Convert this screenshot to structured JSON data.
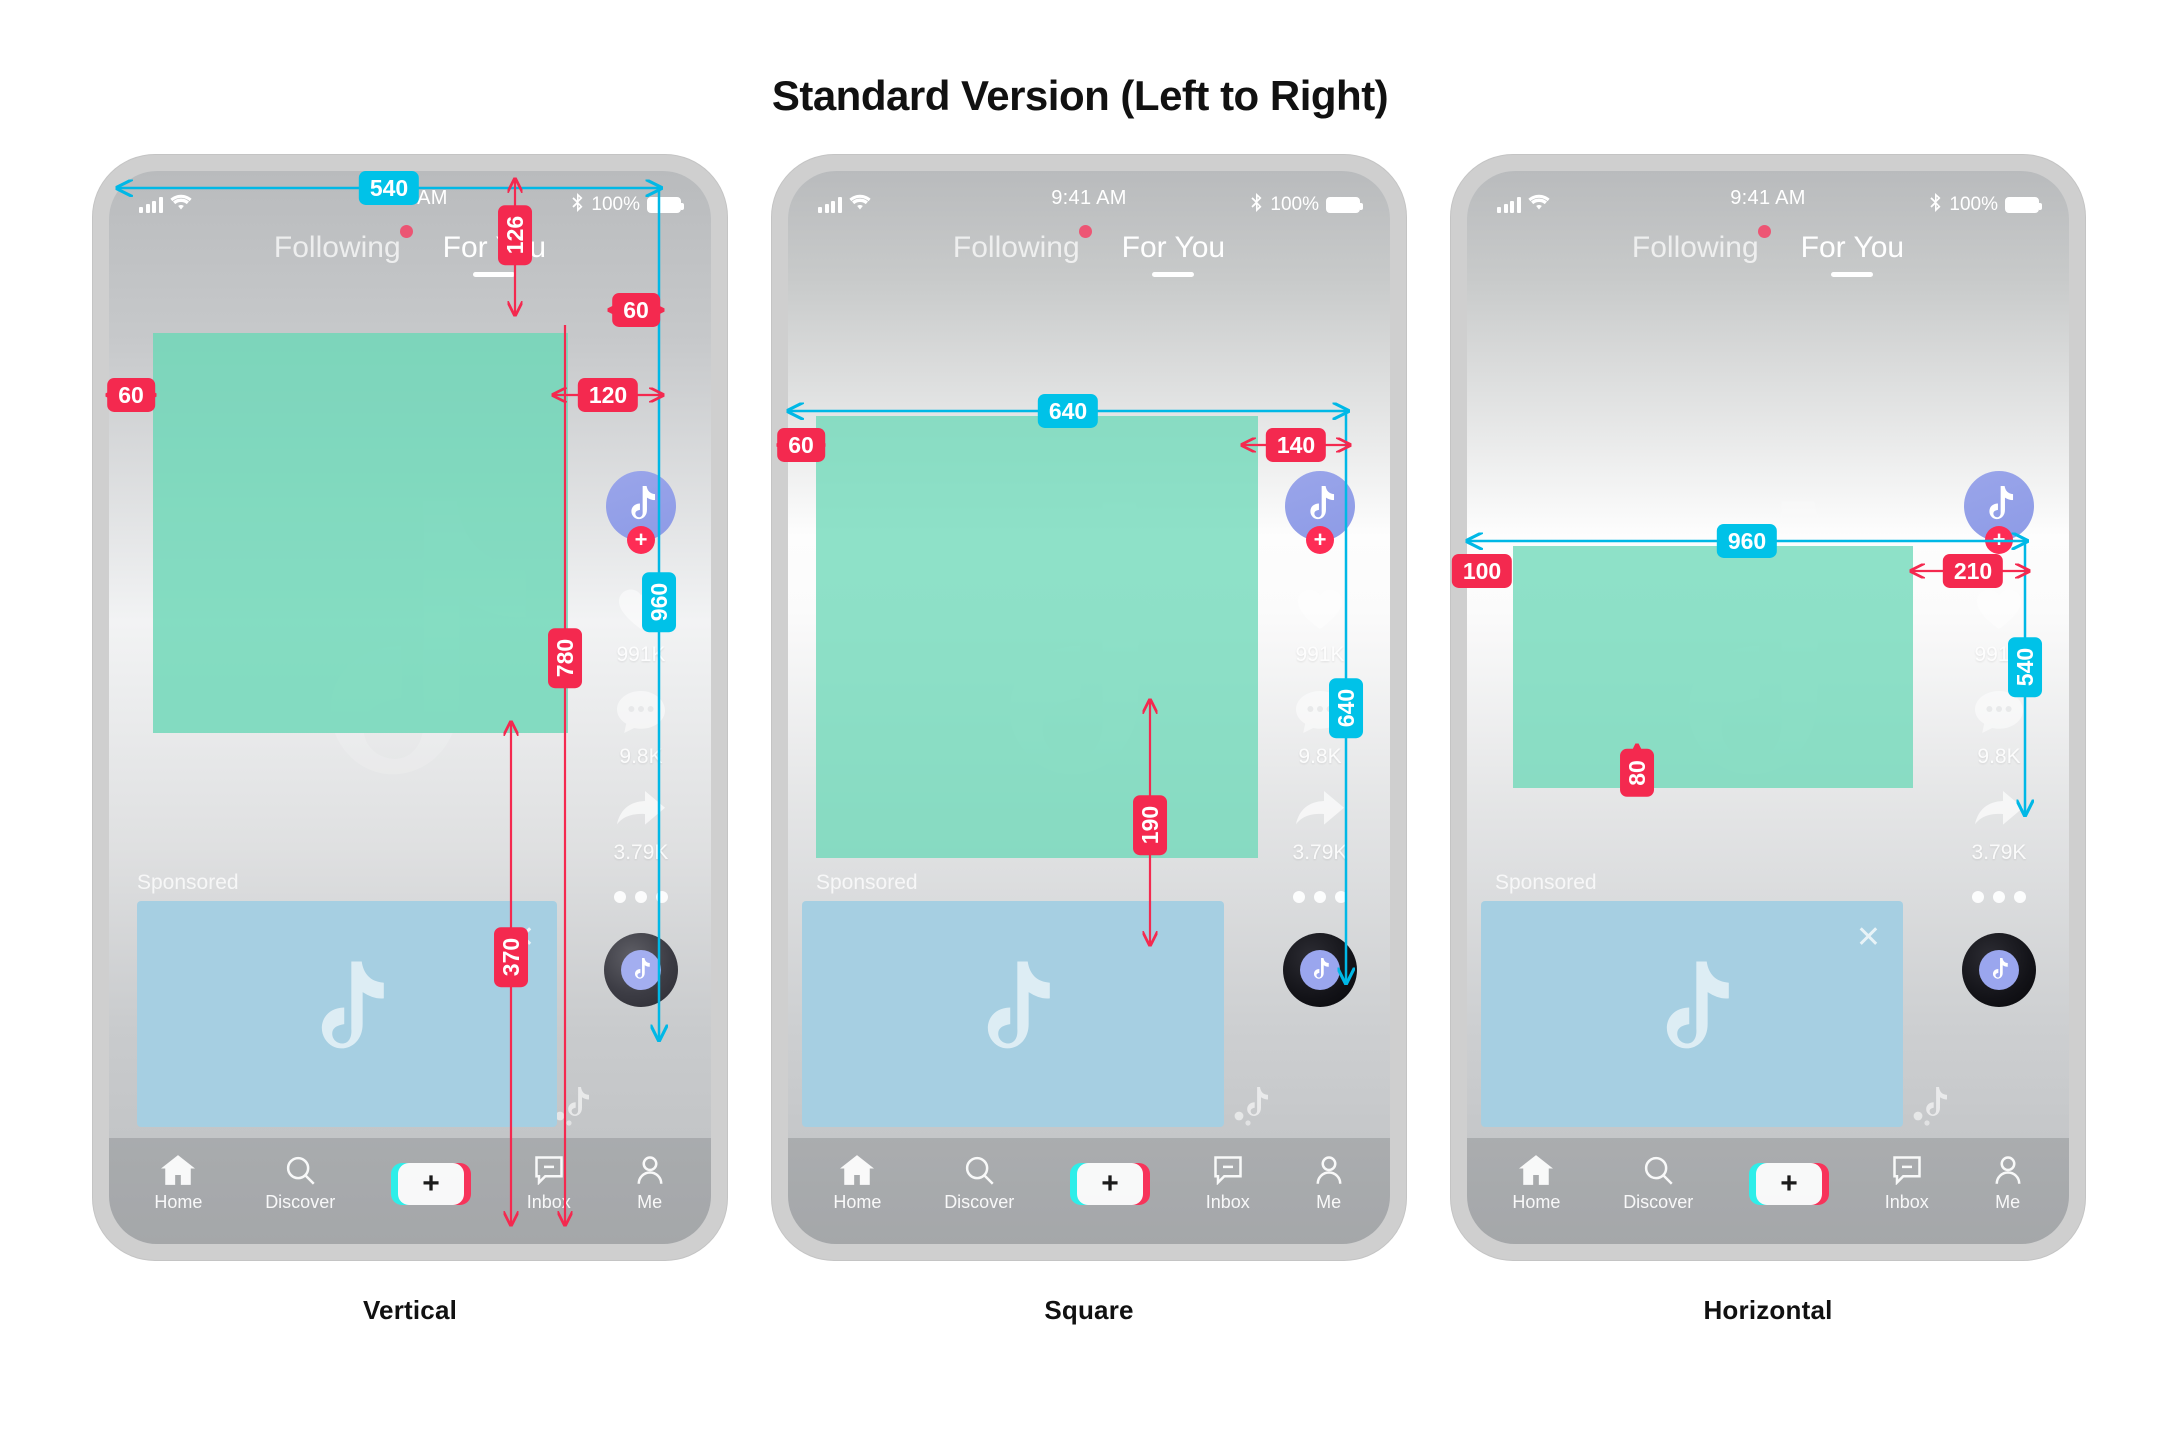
{
  "page": {
    "title": "Standard Version (Left to Right)",
    "accent_cyan": "#00c2e8",
    "accent_red": "#f4294f",
    "safe_zone_green": "#6ed8b8",
    "ad_card_blue": "#a6cfe2"
  },
  "status_bar": {
    "time": "9:41 AM",
    "battery_percent": "100%",
    "signal_icon": "cellular-bars-icon",
    "wifi_icon": "wifi-icon",
    "bluetooth_icon": "bluetooth-icon",
    "battery_icon": "battery-icon"
  },
  "top_tabs": {
    "following": "Following",
    "for_you": "For You",
    "active": "For You"
  },
  "rail": {
    "likes": "991K",
    "comments": "9.8K",
    "shares": "3.79K",
    "avatar_icon": "avatar-icon",
    "follow_icon": "plus-icon",
    "like_icon": "heart-icon",
    "comment_icon": "comment-icon",
    "share_icon": "share-icon",
    "more_icon": "more-dots-icon",
    "music_icon": "music-disc-icon"
  },
  "feed": {
    "sponsored_label": "Sponsored",
    "close_icon": "close-icon"
  },
  "bottom_nav": {
    "items": [
      {
        "label": "Home",
        "icon": "home-icon"
      },
      {
        "label": "Discover",
        "icon": "search-icon"
      },
      {
        "label": "",
        "icon": "create-plus-icon"
      },
      {
        "label": "Inbox",
        "icon": "inbox-icon"
      },
      {
        "label": "Me",
        "icon": "person-icon"
      }
    ],
    "create_glyph": "+"
  },
  "mockups": [
    {
      "caption": "Vertical",
      "annotations": {
        "width_total": "540",
        "top_offset": "126",
        "left_margin": "60",
        "right_margin_top": "60",
        "right_margin": "120",
        "height_total": "960",
        "bottom_band": "780",
        "ad_band": "370"
      }
    },
    {
      "caption": "Square",
      "annotations": {
        "width_total": "640",
        "left_margin": "60",
        "right_margin": "140",
        "height_total": "640",
        "bottom_gap": "190"
      }
    },
    {
      "caption": "Horizontal",
      "annotations": {
        "width_total": "960",
        "left_margin": "100",
        "right_margin": "210",
        "height_total": "540",
        "bottom_gap": "80"
      }
    }
  ]
}
